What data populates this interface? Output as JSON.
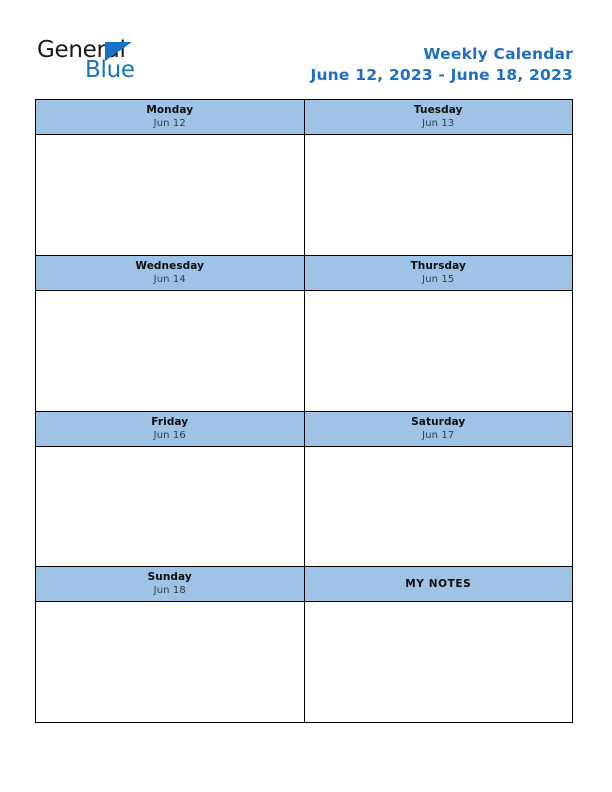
{
  "brand": {
    "name_part1": "General",
    "name_part2": "Blue",
    "triangle_color": "#1572c4",
    "text_color": "#1a1a1a"
  },
  "header": {
    "title": "Weekly Calendar",
    "date_range": "June 12, 2023 - June 18, 2023",
    "title_color": "#1f6fc4"
  },
  "theme": {
    "header_band_color": "#9fc3e7",
    "border_color": "#000000",
    "page_background": "#ffffff",
    "day_name_color": "#0d0d0d",
    "day_date_color": "#2f3b45"
  },
  "calendar": {
    "rows": [
      {
        "cells": [
          {
            "type": "day",
            "day": "Monday",
            "date": "Jun 12",
            "note": ""
          },
          {
            "type": "day",
            "day": "Tuesday",
            "date": "Jun 13",
            "note": ""
          }
        ]
      },
      {
        "cells": [
          {
            "type": "day",
            "day": "Wednesday",
            "date": "Jun 14",
            "note": ""
          },
          {
            "type": "day",
            "day": "Thursday",
            "date": "Jun 15",
            "note": ""
          }
        ]
      },
      {
        "cells": [
          {
            "type": "day",
            "day": "Friday",
            "date": "Jun 16",
            "note": ""
          },
          {
            "type": "day",
            "day": "Saturday",
            "date": "Jun 17",
            "note": ""
          }
        ]
      },
      {
        "cells": [
          {
            "type": "day",
            "day": "Sunday",
            "date": "Jun 18",
            "note": ""
          },
          {
            "type": "notes",
            "day": "MY NOTES",
            "date": "",
            "note": ""
          }
        ]
      }
    ]
  }
}
